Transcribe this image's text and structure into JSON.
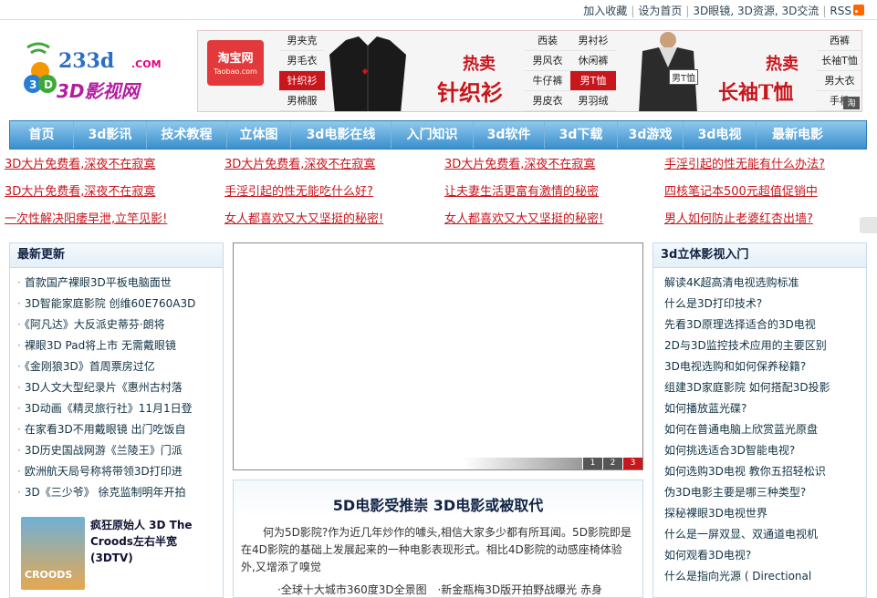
{
  "top_links": {
    "favorite": "加入收藏",
    "homepage": "设为首页",
    "glasses": "3D眼镜",
    "resource": "3D资源",
    "exchange": "3D交流",
    "rss": "RSS"
  },
  "logo": {
    "top": "233d",
    "com": ".COM",
    "brand": "3D影视网"
  },
  "banner": {
    "taobao_cn": "淘宝网",
    "taobao_en": "Taobao.com",
    "col1": [
      "男夹克",
      "男毛衣",
      "针织衫",
      "男棉服"
    ],
    "col2": [
      "西装",
      "男风衣",
      "牛仔裤",
      "男皮衣"
    ],
    "col3": [
      "男衬衫",
      "休闲裤",
      "男T恤",
      "男羽绒"
    ],
    "col4": [
      "西裤",
      "长袖T恤",
      "男大衣",
      "手机"
    ],
    "hot_label": "热卖",
    "product1": "针织衫",
    "product2": "长袖T恤",
    "tag": "男T恤",
    "tb_mark": "淘",
    "highlight_color": "#c8161d"
  },
  "nav": [
    "首页",
    "3d影讯",
    "技术教程",
    "立体图",
    "3d电影在线",
    "入门知识",
    "3d软件",
    "3d下载",
    "3d游戏",
    "3d电视",
    "最新电影"
  ],
  "ad_rows": [
    [
      "3D大片免费看,深夜不在寂寞",
      "3D大片免费看,深夜不在寂寞",
      "3D大片免费看,深夜不在寂寞",
      "手淫引起的性无能有什么办法?"
    ],
    [
      "3D大片免费看,深夜不在寂寞",
      "手淫引起的性无能吃什么好?",
      "让夫妻生活更富有激情的秘密",
      "四核笔记本500元超值促销中"
    ],
    [
      "一次性解决阳痿早泄,立竿见影!",
      "女人都喜欢又大又坚挺的秘密!",
      "女人都喜欢又大又坚挺的秘密!",
      "男人如何防止老婆红杏出墙?"
    ]
  ],
  "latest": {
    "title": "最新更新",
    "items": [
      "首款国产裸眼3D平板电脑面世",
      "3D智能家庭影院 创维60E760A3D",
      "《阿凡达》大反派史蒂芬·朗将",
      "裸眼3D Pad将上市 无需戴眼镜",
      "《金刚狼3D》首周票房过亿",
      "3D人文大型纪录片《惠州古村落",
      "3D动画《精灵旅行社》11月1日登",
      "在家看3D不用戴眼镜 出门吃饭自",
      "3D历史国战网游《兰陵王》门派",
      "欧洲航天局号称将带领3D打印进",
      "3D《三少爷》 徐克监制明年开拍"
    ],
    "featured_title": "疯狂原始人 3D The Croods左右半宽(3DTV)",
    "poster_text": "CROODS"
  },
  "slider": {
    "pages": [
      "1",
      "2",
      "3"
    ],
    "active": 3
  },
  "article": {
    "title": "5D电影受推崇 3D电影或被取代",
    "body": "何为5D影院?作为近几年炒作的噱头,相信大家多少都有所耳闻。5D影院即是在4D影院的基础上发展起来的一种电影表现形式。相比4D影院的动感座椅体验外,又增添了嗅觉",
    "link1": "·全球十大城市360度3D全景图",
    "link2": "·新金瓶梅3D版开拍野战曝光 赤身"
  },
  "intro": {
    "title": "3d立体影视入门",
    "items": [
      "解读4K超高清电视选购标准",
      "什么是3D打印技术?",
      "先看3D原理选择适合的3D电视",
      "2D与3D监控技术应用的主要区别",
      "3D电视选购和如何保养秘籍?",
      "组建3D家庭影院 如何搭配3D投影",
      "如何播放蓝光碟?",
      "如何在普通电脑上欣赏蓝光原盘",
      "如何挑选适合3D智能电视?",
      "如何选购3D电视 教你五招轻松识",
      "伪3D电影主要是哪三种类型?",
      "探秘裸眼3D电视世界",
      "什么是一屏双显、双通道电视机",
      "如何观看3D电视?",
      "什么是指向光源 ( Directional"
    ]
  }
}
